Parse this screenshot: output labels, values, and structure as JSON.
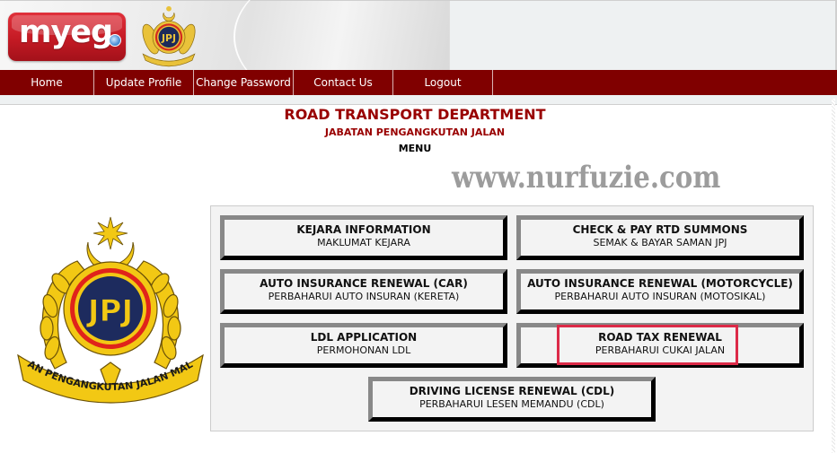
{
  "header": {
    "brand_logo_text": "myeg",
    "agency_emblem": "jpj-emblem-icon"
  },
  "nav": {
    "items": [
      {
        "label": "Home"
      },
      {
        "label": "Update Profile"
      },
      {
        "label": "Change Password"
      },
      {
        "label": "Contact Us"
      },
      {
        "label": "Logout"
      }
    ]
  },
  "page": {
    "title": "ROAD TRANSPORT DEPARTMENT",
    "subtitle": "JABATAN PENGANGKUTAN JALAN",
    "section_label": "MENU",
    "watermark": "www.nurfuzie.com",
    "emblem_ribbon_text": "JABATAN PENGANGKUTAN JALAN MALAYSIA",
    "emblem_monogram": "JPJ"
  },
  "menu": {
    "buttons": [
      {
        "title": "KEJARA INFORMATION",
        "subtitle": "MAKLUMAT KEJARA"
      },
      {
        "title": "CHECK & PAY RTD SUMMONS",
        "subtitle": "SEMAK & BAYAR SAMAN JPJ"
      },
      {
        "title": "AUTO INSURANCE RENEWAL (CAR)",
        "subtitle": "PERBAHARUI AUTO INSURAN (KERETA)"
      },
      {
        "title": "AUTO INSURANCE RENEWAL (MOTORCYCLE)",
        "subtitle": "PERBAHARUI AUTO INSURAN (MOTOSIKAL)"
      },
      {
        "title": "LDL APPLICATION",
        "subtitle": "PERMOHONAN LDL"
      },
      {
        "title": "ROAD TAX RENEWAL",
        "subtitle": "PERBAHARUI CUKAI JALAN",
        "highlighted": true
      },
      {
        "title": "DRIVING LICENSE RENEWAL (CDL)",
        "subtitle": "PERBAHARUI LESEN MEMANDU (CDL)"
      }
    ]
  },
  "colors": {
    "nav_bg": "#800000",
    "title_red": "#990000",
    "highlight": "#dc2a48",
    "watermark_gray": "#9c9c9c"
  }
}
